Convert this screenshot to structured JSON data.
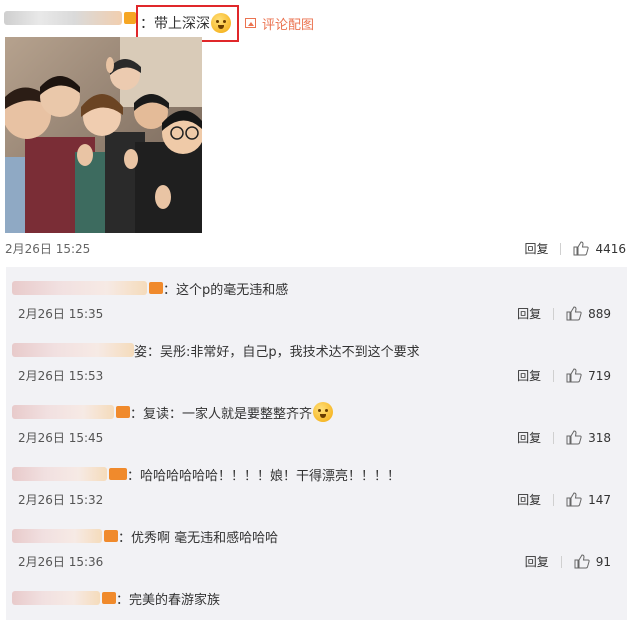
{
  "main_comment": {
    "content": "：带上深深",
    "picture_link": "评论配图",
    "timestamp": "2月26日 15:25",
    "reply_label": "回复",
    "likes": "4416"
  },
  "replies": [
    {
      "content": "：这个p的毫无违和感",
      "timestamp": "2月26日 15:35",
      "reply_label": "回复",
      "likes": "889"
    },
    {
      "content": "姿：吴彤:非常好，自己p，我技术达不到这个要求",
      "timestamp": "2月26日 15:53",
      "reply_label": "回复",
      "likes": "719"
    },
    {
      "content": "：复读：一家人就是要整整齐齐",
      "timestamp": "2月26日 15:45",
      "reply_label": "回复",
      "likes": "318"
    },
    {
      "content": "：哈哈哈哈哈哈！！！！娘！干得漂亮！！！！",
      "timestamp": "2月26日 15:32",
      "reply_label": "回复",
      "likes": "147"
    },
    {
      "content": "：优秀啊 毫无违和感哈哈哈",
      "timestamp": "2月26日 15:36",
      "reply_label": "回复",
      "likes": "91"
    },
    {
      "content": "：完美的春游家族",
      "timestamp": "",
      "reply_label": "",
      "likes": ""
    }
  ],
  "colors": {
    "accent": "#eb7350",
    "highlight_border": "#e0272a",
    "reply_bg": "#f2f2f5"
  },
  "icons": [
    "picture-icon",
    "thumbs-up-icon",
    "emoji-icon",
    "vip-badge-icon"
  ]
}
